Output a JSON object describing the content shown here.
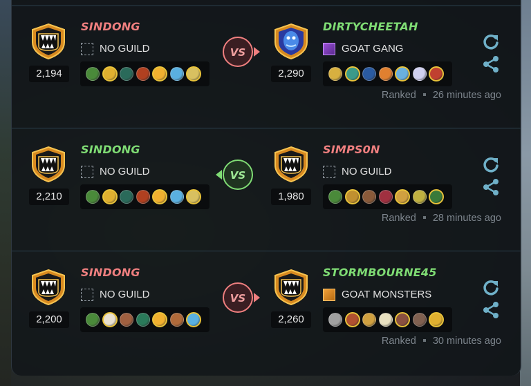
{
  "colors": {
    "winner": "#7fdc74",
    "loser": "#ef7f7f",
    "action_icon": "#6fb0c8",
    "gold": "#e8c23a"
  },
  "vs_label": "VS",
  "battles": [
    {
      "left": {
        "name": "SINDONG",
        "status": "loser",
        "rating": "2,194",
        "guild": "NO GUILD",
        "guild_icon": "no-guild",
        "avatar": "monster",
        "cards": [
          "#4a8a3a",
          "#e0b030",
          "#2a6a5a",
          "#b04020",
          "#f0b030",
          "#5ab0e0",
          "#d8c060"
        ]
      },
      "right": {
        "name": "DIRTYCHEETAH",
        "status": "winner",
        "rating": "2,290",
        "guild": "GOAT GANG",
        "guild_icon": "purple",
        "avatar": "blue-ghost",
        "cards": [
          "#d8b040",
          "#3a9a8a",
          "#2a5aa0",
          "#e08030",
          "#6ab0e0",
          "#d0d0f0",
          "#c04030"
        ]
      },
      "winner_side": "right",
      "mode": "Ranked",
      "time": "26 minutes ago"
    },
    {
      "left": {
        "name": "SINDONG",
        "status": "winner",
        "rating": "2,210",
        "guild": "NO GUILD",
        "guild_icon": "no-guild",
        "avatar": "monster",
        "cards": [
          "#4a8a3a",
          "#e0b030",
          "#2a6a5a",
          "#b04020",
          "#f0b030",
          "#5ab0e0",
          "#d8c060"
        ]
      },
      "right": {
        "name": "SIMPS0N",
        "status": "loser",
        "rating": "1,980",
        "guild": "NO GUILD",
        "guild_icon": "no-guild",
        "avatar": "monster",
        "cards": [
          "#4a8a3a",
          "#c09030",
          "#8a5a3a",
          "#a03040",
          "#d0a040",
          "#c0b040",
          "#3a7a3a"
        ]
      },
      "winner_side": "left",
      "mode": "Ranked",
      "time": "28 minutes ago"
    },
    {
      "left": {
        "name": "SINDONG",
        "status": "loser",
        "rating": "2,200",
        "guild": "NO GUILD",
        "guild_icon": "no-guild",
        "avatar": "monster",
        "cards": [
          "#4a8a3a",
          "#e8e0d0",
          "#a06040",
          "#2a7a5a",
          "#f0b030",
          "#b06a3a",
          "#5ab0e0"
        ]
      },
      "right": {
        "name": "STORMBOURNE45",
        "status": "winner",
        "rating": "2,260",
        "guild": "GOAT MONSTERS",
        "guild_icon": "orange",
        "avatar": "monster",
        "cards": [
          "#a0a0a0",
          "#b05030",
          "#d0a040",
          "#e8e0c0",
          "#8a5040",
          "#806050",
          "#e0b030"
        ]
      },
      "winner_side": "right",
      "mode": "Ranked",
      "time": "30 minutes ago"
    }
  ]
}
